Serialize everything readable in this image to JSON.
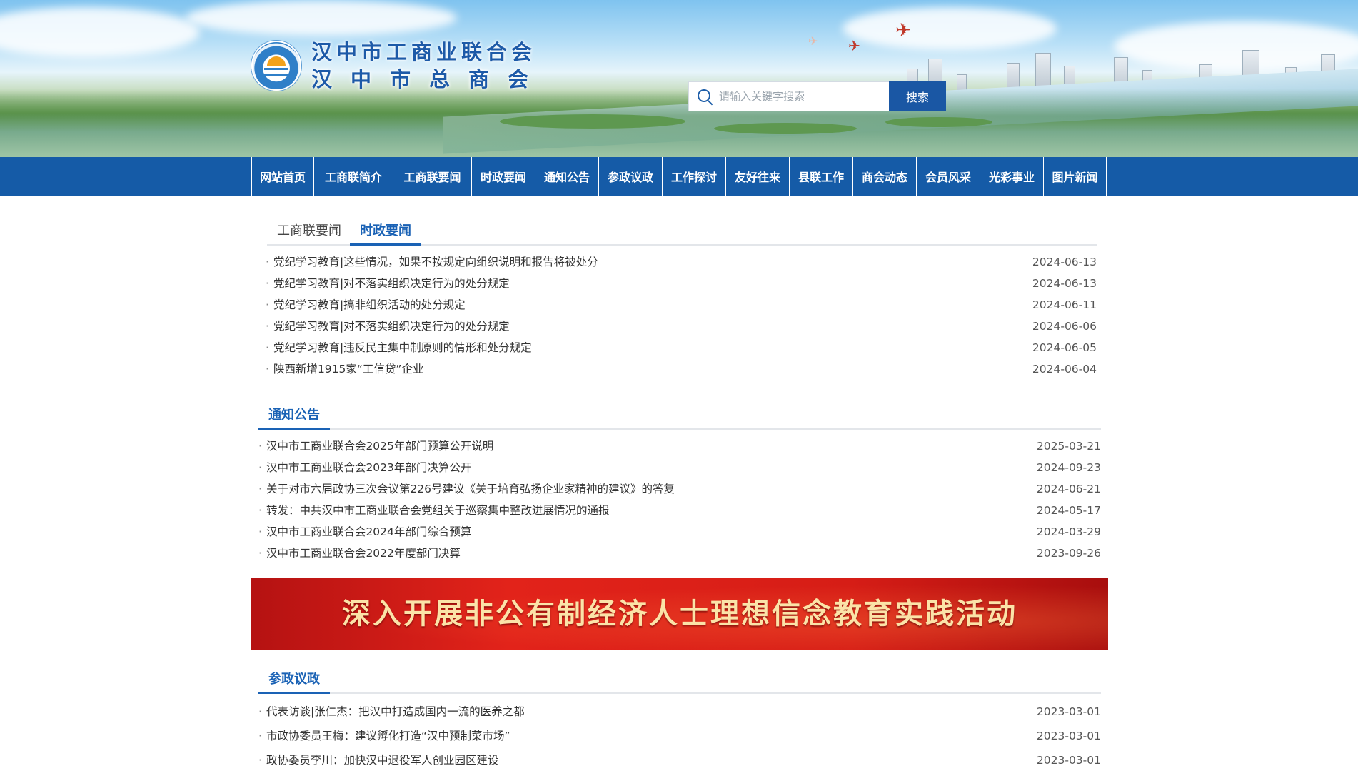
{
  "header": {
    "org_name_1": "汉中市工商业联合会",
    "org_name_2": "汉中市总商会",
    "search": {
      "placeholder": "请输入关键字搜索",
      "button_label": "搜索"
    }
  },
  "nav": {
    "items": [
      "网站首页",
      "工商联简介",
      "工商联要闻",
      "时政要闻",
      "通知公告",
      "参政议政",
      "工作探讨",
      "友好往来",
      "县联工作",
      "商会动态",
      "会员风采",
      "光彩事业",
      "图片新闻"
    ]
  },
  "news_tabs": {
    "tabs": [
      "工商联要闻",
      "时政要闻"
    ],
    "active_tab": "时政要闻",
    "items": [
      {
        "title": "党纪学习教育|这些情况，如果不按规定向组织说明和报告将被处分",
        "date": "2024-06-13"
      },
      {
        "title": "党纪学习教育|对不落实组织决定行为的处分规定",
        "date": "2024-06-13"
      },
      {
        "title": "党纪学习教育|搞非组织活动的处分规定",
        "date": "2024-06-11"
      },
      {
        "title": "党纪学习教育|对不落实组织决定行为的处分规定",
        "date": "2024-06-06"
      },
      {
        "title": "党纪学习教育|违反民主集中制原则的情形和处分规定",
        "date": "2024-06-05"
      },
      {
        "title": "陕西新增1915家“工信贷”企业",
        "date": "2024-06-04"
      }
    ]
  },
  "notices": {
    "title": "通知公告",
    "items": [
      {
        "title": "汉中市工商业联合会2025年部门预算公开说明",
        "date": "2025-03-21"
      },
      {
        "title": "汉中市工商业联合会2023年部门决算公开",
        "date": "2024-09-23"
      },
      {
        "title": "关于对市六届政协三次会议第226号建议《关于培育弘扬企业家精神的建议》的答复",
        "date": "2024-06-21"
      },
      {
        "title": "转发：中共汉中市工商业联合会党组关于巡察集中整改进展情况的通报",
        "date": "2024-05-17"
      },
      {
        "title": "汉中市工商业联合会2024年部门综合预算",
        "date": "2024-03-29"
      },
      {
        "title": "汉中市工商业联合会2022年度部门决算",
        "date": "2023-09-26"
      }
    ]
  },
  "promo_banner": {
    "text": "深入开展非公有制经济人士理想信念教育实践活动"
  },
  "politics": {
    "title": "参政议政",
    "items": [
      {
        "title": "代表访谈|张仁杰：把汉中打造成国内一流的医养之都",
        "date": "2023-03-01"
      },
      {
        "title": "市政协委员王梅：建议孵化打造“汉中预制菜市场”",
        "date": "2023-03-01"
      },
      {
        "title": "政协委员李川：加快汉中退役军人创业园区建设",
        "date": "2023-03-01"
      }
    ]
  },
  "colors": {
    "nav_bg": "#155ba7",
    "accent": "#1a62b5",
    "promo_red": "#e2231a"
  }
}
